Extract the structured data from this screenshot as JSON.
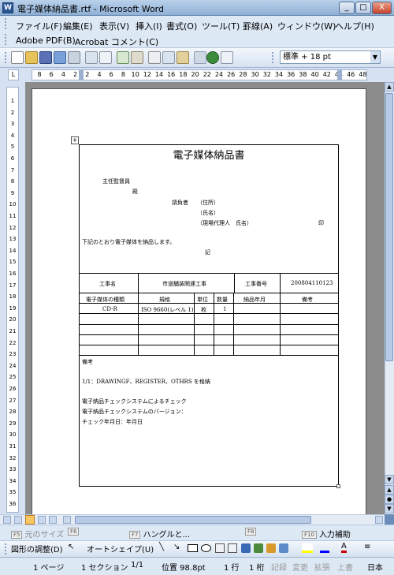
{
  "window": {
    "title": "電子媒体納品書.rtf - Microsoft Word",
    "min_label": "_",
    "max_label": "□",
    "close_label": "X"
  },
  "menu": [
    {
      "label": "ファイル(F)"
    },
    {
      "label": "編集(E)"
    },
    {
      "label": "表示(V)"
    },
    {
      "label": "挿入(I)"
    },
    {
      "label": "書式(O)"
    },
    {
      "label": "ツール(T)"
    },
    {
      "label": "罫線(A)"
    },
    {
      "label": "ウィンドウ(W)"
    },
    {
      "label": "ヘルプ(H)"
    }
  ],
  "acrobat_menu": [
    {
      "label": "Adobe PDF(B)"
    },
    {
      "label": "Acrobat コメント(C)"
    }
  ],
  "toolbar": {
    "style_value": "標準 + 18 pt"
  },
  "ruler": {
    "numbers": [
      "8",
      "6",
      "4",
      "2",
      "2",
      "4",
      "6",
      "8",
      "10",
      "12",
      "14",
      "16",
      "18",
      "20",
      "22",
      "24",
      "26",
      "28",
      "30",
      "32",
      "34",
      "36",
      "38",
      "40",
      "42",
      "44",
      "46",
      "48"
    ],
    "vertical_numbers": [
      "1",
      "2",
      "3",
      "4",
      "5",
      "6",
      "7",
      "8",
      "9",
      "10",
      "11",
      "12",
      "13",
      "14",
      "15",
      "16",
      "17",
      "18",
      "19",
      "20",
      "21",
      "22",
      "23",
      "24",
      "25",
      "26",
      "27",
      "28",
      "29",
      "30",
      "31",
      "32",
      "33",
      "34",
      "35",
      "36"
    ]
  },
  "document": {
    "title": "電子媒体納品書",
    "supervisor_label": "主任監督員",
    "honorific": "殿",
    "contractor_label": "請負者",
    "address_label": "（住所）",
    "name_label": "（氏名）",
    "agent_label": "（現場代理人　氏名）",
    "seal": "印",
    "intro": "下記のとおり電子媒体を納品します。",
    "ki": "記",
    "construction_name_label": "工事名",
    "construction_name_value": "市道舗装関連工事",
    "construction_no_label": "工事番号",
    "construction_no_value": "200804110123",
    "columns": [
      "電子媒体の種類",
      "規格",
      "単位",
      "数量",
      "納品年月",
      "備考"
    ],
    "row1": [
      "CD-R",
      "ISO 9660(レベル 1)",
      "枚",
      "1",
      "",
      ""
    ],
    "remarks_label": "備考",
    "remarks_line1": "1/1：DRAWINGF、REGISTER、OTHRS を格納",
    "remarks_line2": "電子納品チェックシステムによるチェック",
    "remarks_line3": "電子納品チェックシステムのバージョン：",
    "remarks_line4": "チェック年月日：年月日"
  },
  "fkeys": [
    {
      "key": "F5",
      "label": "元のサイズ"
    },
    {
      "key": "F6",
      "label": ""
    },
    {
      "key": "F7",
      "label": "ハングルと..."
    },
    {
      "key": "F8",
      "label": ""
    },
    {
      "key": "F10",
      "label": "入力補助"
    }
  ],
  "drawing": {
    "adjust_label": "図形の調整(D)",
    "autoshape_label": "オートシェイプ(U)"
  },
  "status": {
    "page": "1 ページ",
    "section": "1 セクション",
    "pages": "1/1",
    "position": "位置 98.8pt",
    "line": "1 行",
    "column": "1 桁",
    "rec": "記録",
    "trk": "変更",
    "ext": "拡張",
    "ovr": "上書",
    "lang": "日本"
  },
  "colors": {
    "titlebar": "#b9d1ea",
    "close_button": "#c7412a",
    "workspace": "#8c8c8c"
  }
}
